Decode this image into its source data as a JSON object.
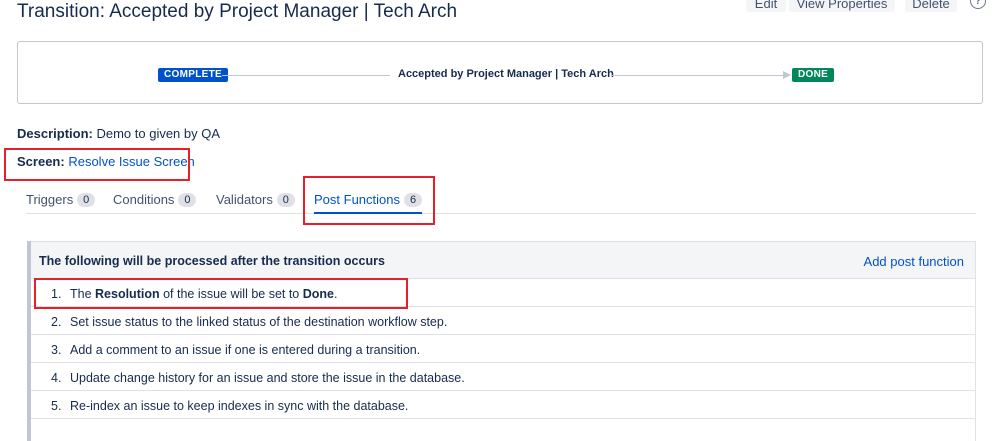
{
  "page": {
    "title": "Transition: Accepted by Project Manager | Tech Arch",
    "actions": {
      "edit": "Edit",
      "view_properties": "View Properties",
      "delete": "Delete",
      "help": "?"
    }
  },
  "diagram": {
    "from_status": "COMPLETE",
    "transition": "Accepted by Project Manager | Tech Arch",
    "to_status": "DONE",
    "from_color": "#0052cc",
    "to_color": "#00875a"
  },
  "description": {
    "label": "Description:",
    "value": "Demo to given by QA"
  },
  "screen": {
    "label": "Screen:",
    "value": "Resolve Issue Screen"
  },
  "tabs": [
    {
      "label": "Triggers",
      "count": "0"
    },
    {
      "label": "Conditions",
      "count": "0"
    },
    {
      "label": "Validators",
      "count": "0"
    },
    {
      "label": "Post Functions",
      "count": "6",
      "active": true
    }
  ],
  "post_functions": {
    "header": "The following will be processed after the transition occurs",
    "add_link": "Add post function",
    "items": [
      {
        "num": "1.",
        "pre": "The ",
        "b1": "Resolution",
        "mid": " of the issue will be set to ",
        "b2": "Done",
        "post": "."
      },
      {
        "num": "2.",
        "text": "Set issue status to the linked status of the destination workflow step."
      },
      {
        "num": "3.",
        "text": "Add a comment to an issue if one is entered during a transition."
      },
      {
        "num": "4.",
        "text": "Update change history for an issue and store the issue in the database."
      },
      {
        "num": "5.",
        "text": "Re-index an issue to keep indexes in sync with the database."
      }
    ]
  },
  "colors": {
    "highlight": "#e5202a",
    "link": "#0052cc"
  }
}
